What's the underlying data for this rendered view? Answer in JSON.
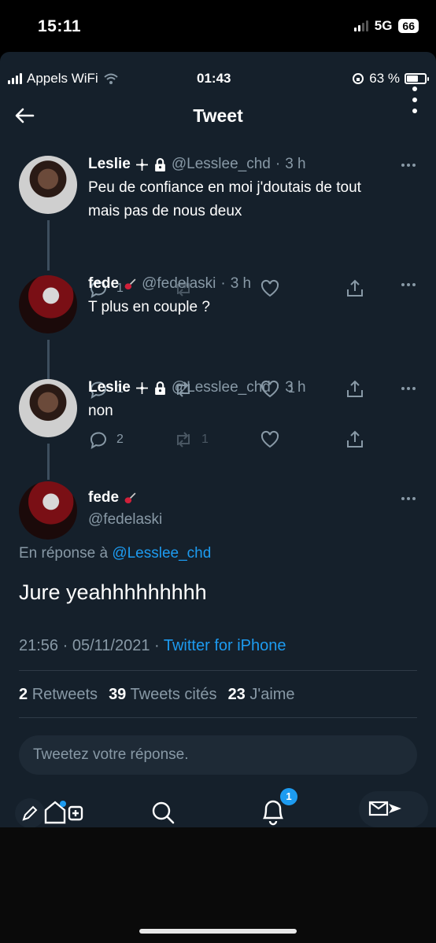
{
  "outer_status": {
    "time": "15:11",
    "network": "5G",
    "battery": "66"
  },
  "inner_status": {
    "carrier": "Appels WiFi",
    "time": "01:43",
    "battery": "63 %"
  },
  "header": {
    "title": "Tweet"
  },
  "thread": [
    {
      "name": "Leslie",
      "handle": "@Lesslee_chd",
      "time": "3 h",
      "text_lines": [
        "Peu de confiance en moi j'doutais de tout",
        "mais pas de nous deux"
      ],
      "replies": "1",
      "retweets": "",
      "likes": ""
    },
    {
      "name": "fede",
      "handle": "@fedelaski",
      "time": "3 h",
      "text_lines": [
        "T plus en couple ?"
      ],
      "replies": "1",
      "retweets": "",
      "likes": "1"
    },
    {
      "name": "Leslie",
      "handle": "@Lesslee_chd",
      "time": "3 h",
      "text_lines": [
        "non"
      ],
      "replies": "2",
      "retweets": "1",
      "likes": ""
    }
  ],
  "main_tweet": {
    "name": "fede",
    "handle": "@fedelaski",
    "reply_prefix": "En réponse à",
    "reply_handle": "@Lesslee_chd",
    "text": "Jure yeahhhhhhhhh",
    "timestamp": "21:56 · 05/11/2021 ·",
    "source": "Twitter for iPhone",
    "retweets_count": "2",
    "retweets_label": "Retweets",
    "quotes_count": "39",
    "quotes_label": "Tweets cités",
    "likes_count": "23",
    "likes_label": "J'aime"
  },
  "reply_box": {
    "placeholder": "Tweetez votre réponse."
  },
  "tabbar": {
    "notification_badge": "1"
  },
  "colors": {
    "background": "#15202b",
    "accent": "#1d9bf0",
    "muted": "#8899a6"
  }
}
